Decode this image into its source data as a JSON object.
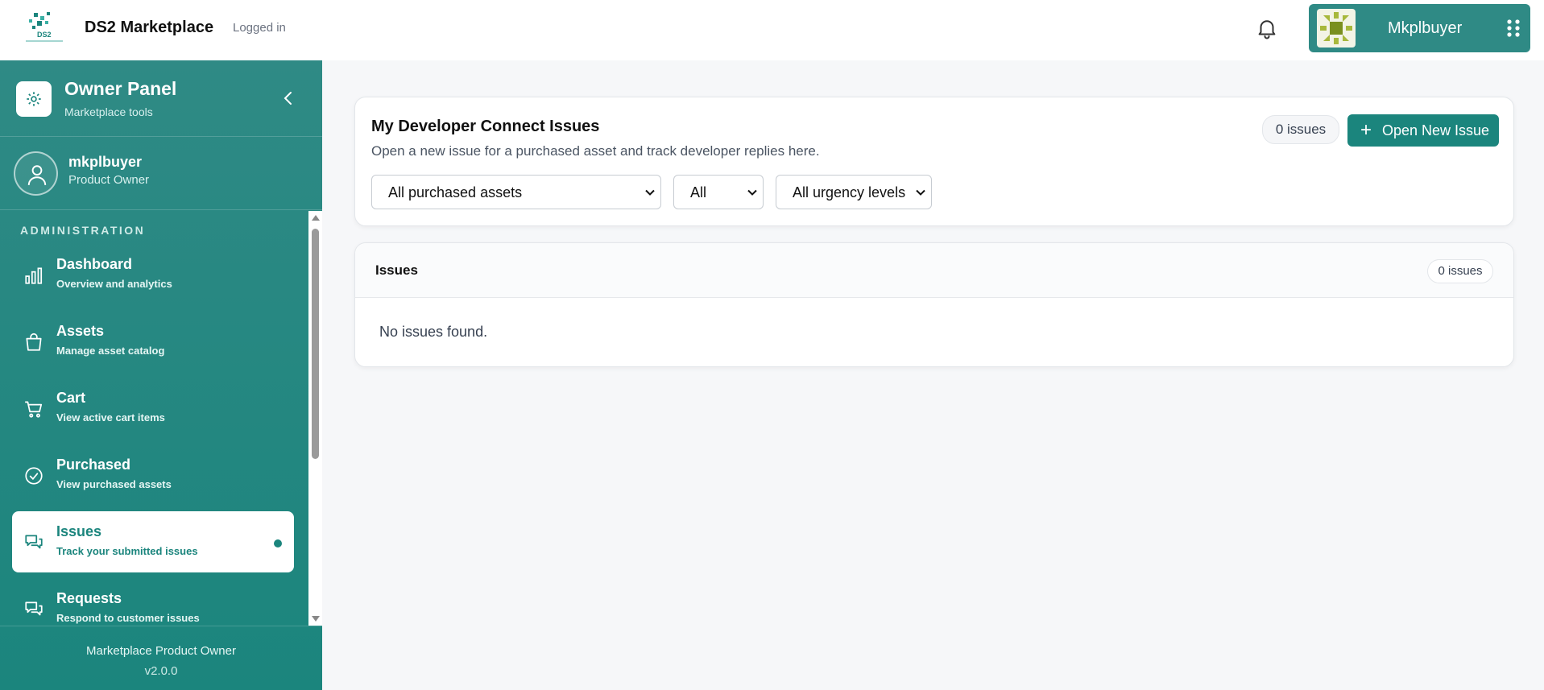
{
  "header": {
    "brand": "DS2 Marketplace",
    "status": "Logged in",
    "username": "Mkplbuyer",
    "icons": {
      "logo": "ds2-logo",
      "notifications": "bell-icon",
      "apps": "grid-icon"
    }
  },
  "sidebar": {
    "title": "Owner Panel",
    "subtitle": "Marketplace tools",
    "profile": {
      "name": "mkplbuyer",
      "role": "Product Owner"
    },
    "section_label": "ADMINISTRATION",
    "items": [
      {
        "label": "Dashboard",
        "sub": "Overview and analytics",
        "icon": "bar-chart-icon"
      },
      {
        "label": "Assets",
        "sub": "Manage asset catalog",
        "icon": "bag-icon"
      },
      {
        "label": "Cart",
        "sub": "View active cart items",
        "icon": "cart-icon"
      },
      {
        "label": "Purchased",
        "sub": "View purchased assets",
        "icon": "check-circle-icon"
      },
      {
        "label": "Issues",
        "sub": "Track your submitted issues",
        "icon": "chat-icon",
        "active": true
      },
      {
        "label": "Requests",
        "sub": "Respond to customer issues",
        "icon": "chat-icon"
      }
    ],
    "footer": {
      "line1": "Marketplace Product Owner",
      "version": "v2.0.0"
    }
  },
  "main": {
    "title": "My Developer Connect Issues",
    "description": "Open a new issue for a purchased asset and track developer replies here.",
    "count_badge": "0 issues",
    "new_button": "Open New Issue",
    "filters": {
      "asset": "All purchased assets",
      "status": "All",
      "urgency": "All urgency levels"
    },
    "issues_card": {
      "title": "Issues",
      "count_badge": "0 issues",
      "empty_message": "No issues found."
    }
  },
  "colors": {
    "accent": "#1b857d",
    "sidebar": "#2f8a85"
  }
}
